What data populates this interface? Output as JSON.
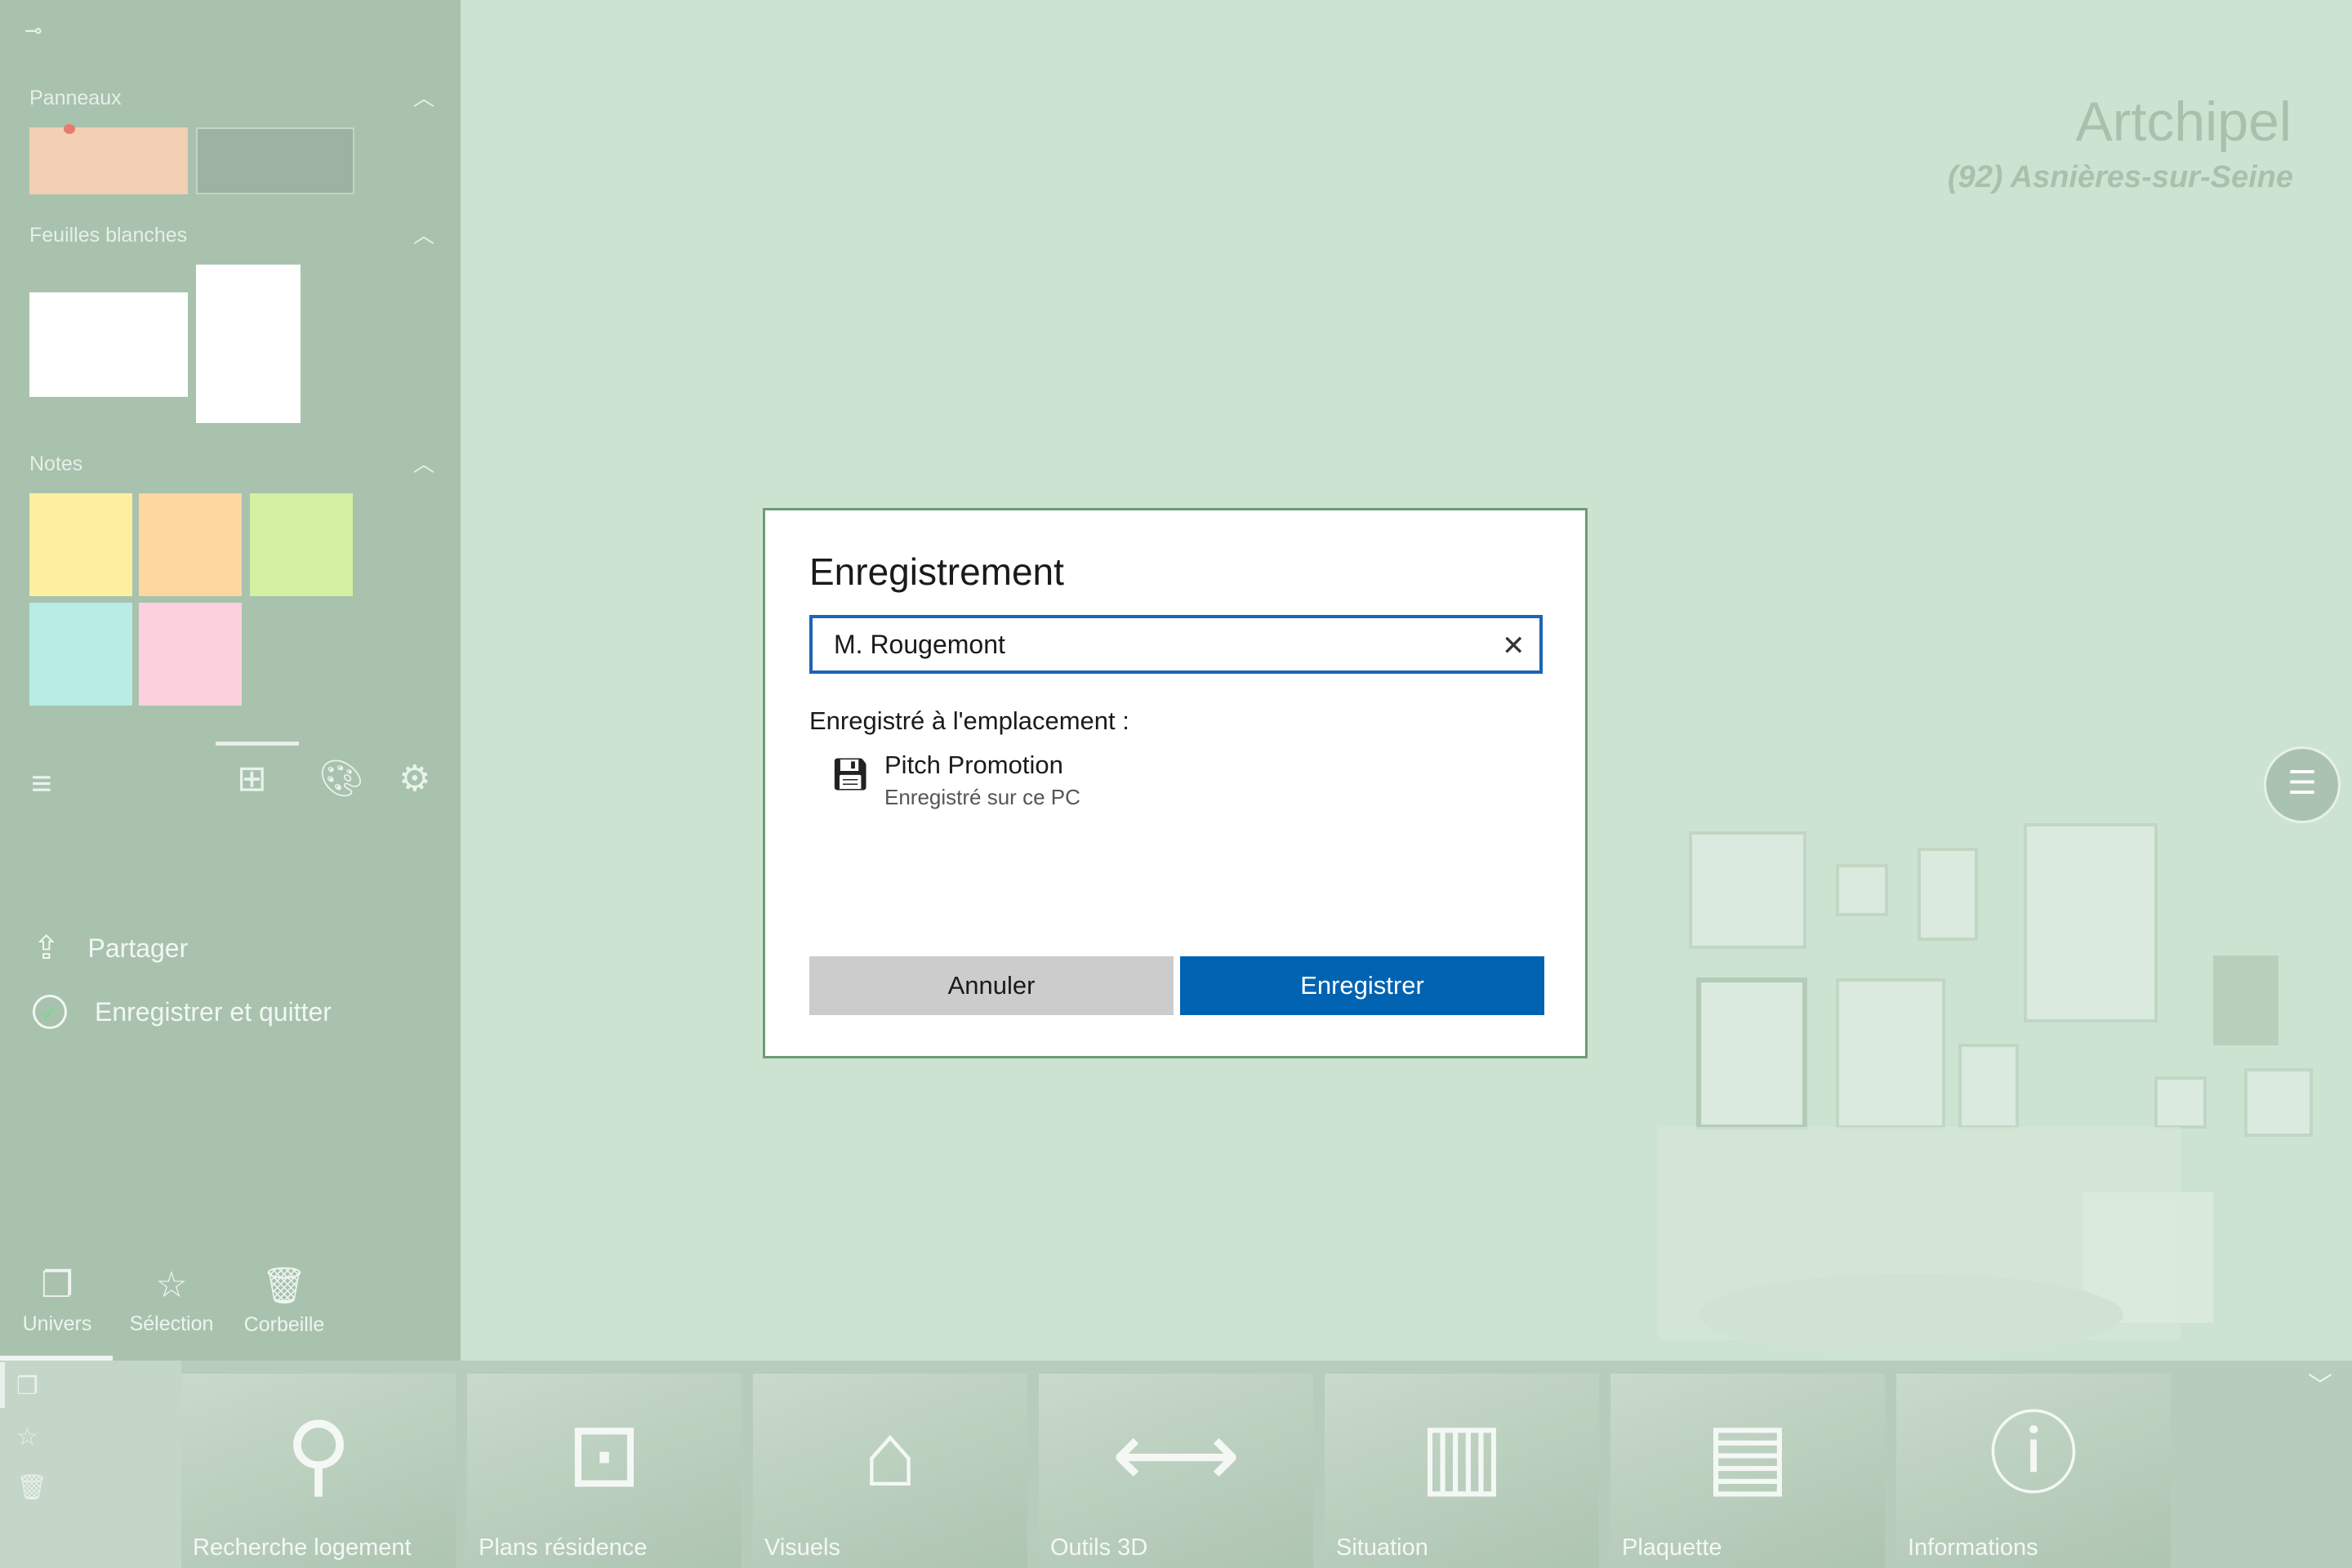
{
  "sidebar": {
    "sections": [
      {
        "title": "Panneaux"
      },
      {
        "title": "Feuilles blanches"
      },
      {
        "title": "Notes"
      }
    ],
    "actions": [
      {
        "label": "Partager",
        "icon": "share-icon"
      },
      {
        "label": "Enregistrer et quitter",
        "icon": "check-circle-icon"
      }
    ],
    "bottom_nav": [
      {
        "label": "Univers",
        "icon": "layers-icon"
      },
      {
        "label": "Sélection",
        "icon": "star-list-icon"
      },
      {
        "label": "Corbeille",
        "icon": "trash-icon"
      }
    ]
  },
  "header": {
    "brand": "Artchipel",
    "city": "(92) Asnières-sur-Seine"
  },
  "bottom_tiles": [
    {
      "label": "Recherche logement",
      "icon": "magnifier-icon"
    },
    {
      "label": "Plans résidence",
      "icon": "floorplan-icon"
    },
    {
      "label": "Visuels",
      "icon": "house-icon"
    },
    {
      "label": "Outils 3D",
      "icon": "panorama-icon"
    },
    {
      "label": "Situation",
      "icon": "map-icon"
    },
    {
      "label": "Plaquette",
      "icon": "brochure-icon"
    },
    {
      "label": "Informations",
      "icon": "info-icon"
    }
  ],
  "dialog": {
    "title": "Enregistrement",
    "input_value": "M. Rougemont",
    "location_label": "Enregistré à l'emplacement :",
    "location_name": "Pitch Promotion",
    "location_sub": "Enregistré sur ce PC",
    "cancel_label": "Annuler",
    "save_label": "Enregistrer"
  },
  "colors": {
    "background": "#cde3d2",
    "sidebar": "#a8c2ae",
    "primary_button": "#0063b1",
    "input_border": "#1c64b4"
  }
}
